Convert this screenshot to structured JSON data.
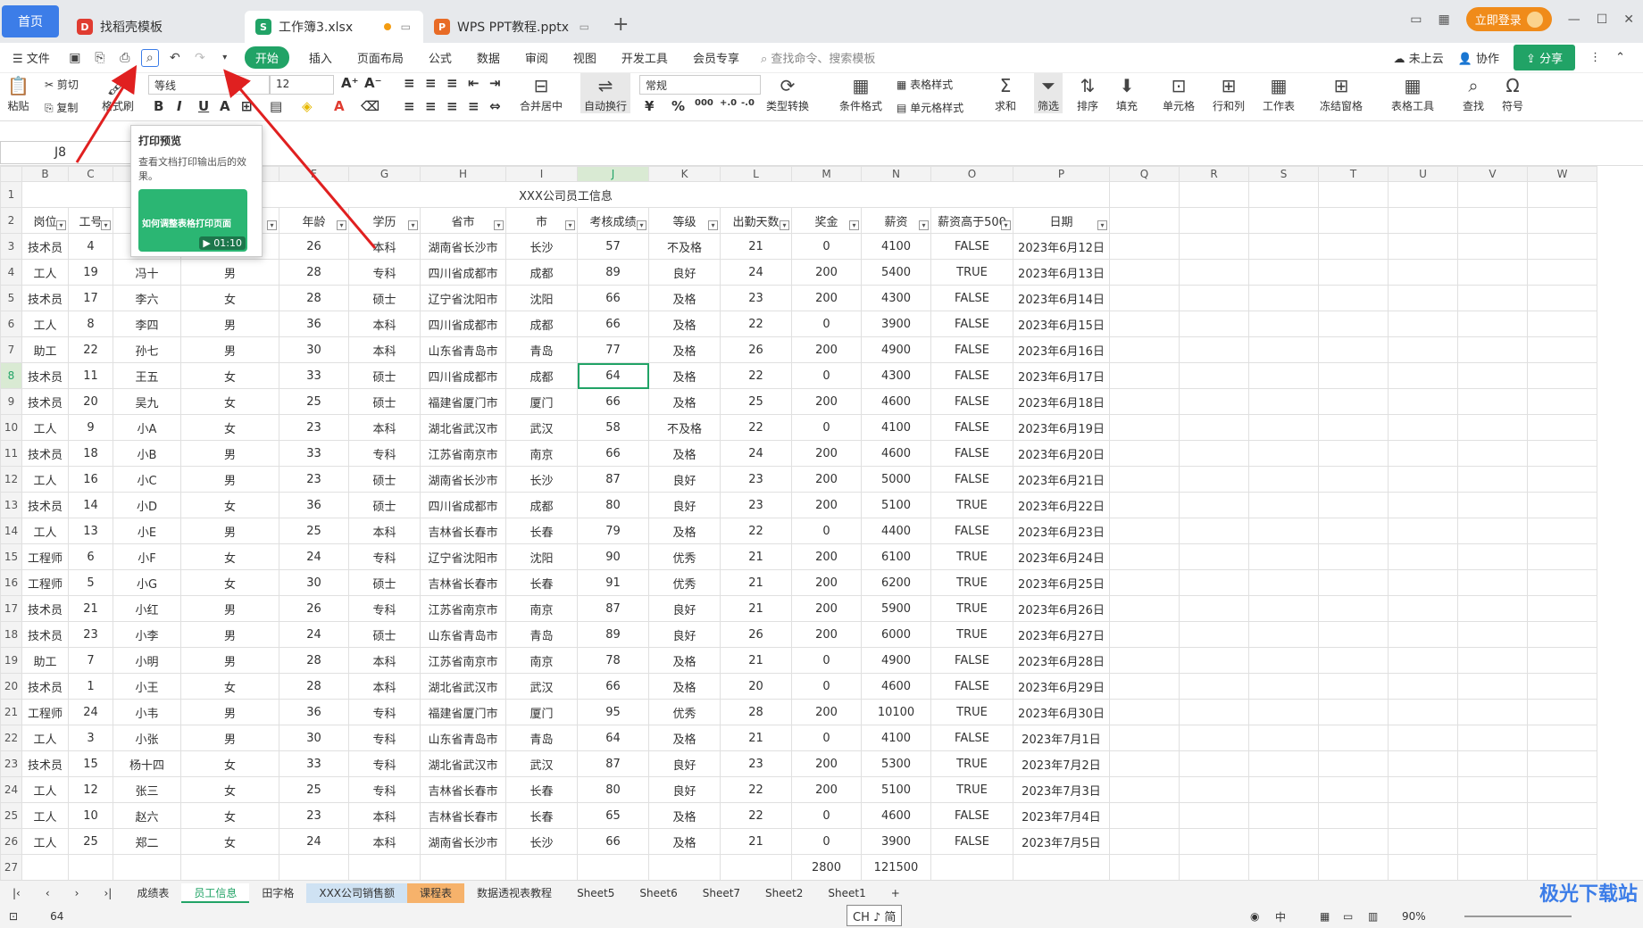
{
  "titlebar": {
    "tabs": [
      {
        "label": "首页"
      },
      {
        "label": "找稻壳模板"
      },
      {
        "label": "工作簿3.xlsx"
      },
      {
        "label": "WPS PPT教程.pptx"
      }
    ],
    "login": "立即登录"
  },
  "menu": {
    "file": "文件",
    "items": [
      "开始",
      "插入",
      "页面布局",
      "公式",
      "数据",
      "审阅",
      "视图",
      "开发工具",
      "会员专享"
    ],
    "search": "查找命令、搜索模板",
    "cloud": "未上云",
    "collab": "协作",
    "share": "分享"
  },
  "ribbon": {
    "cut": "剪切",
    "paste": "粘贴",
    "copy": "复制",
    "fmtbrush": "格式刷",
    "font": "等线",
    "size": "12",
    "merge": "合并居中",
    "wrap": "自动换行",
    "numfmt": "常规",
    "typeconv": "类型转换",
    "condfmt": "条件格式",
    "tablestyle": "表格样式",
    "cellstyle": "单元格样式",
    "sum": "求和",
    "filter": "筛选",
    "sort": "排序",
    "fill": "填充",
    "cell": "单元格",
    "rowcol": "行和列",
    "sheet": "工作表",
    "freeze": "冻结窗格",
    "tabletool": "表格工具",
    "find": "查找",
    "symbol": "符号",
    "currency": "¥",
    "percent": "%",
    "thousands": "000"
  },
  "namebox": "J8",
  "tooltip": {
    "title": "打印预览",
    "desc": "查看文档打印输出后的效果。",
    "card_title": "如何调整表格打印页面",
    "duration": "01:10"
  },
  "columns": [
    "B",
    "C",
    "D",
    "E",
    "F",
    "G",
    "H",
    "I",
    "J",
    "K",
    "L",
    "M",
    "N",
    "O",
    "P",
    "Q",
    "R",
    "S",
    "T",
    "U",
    "V",
    "W"
  ],
  "title_row": "XXX公司员工信息",
  "headers": [
    "岗位",
    "工号",
    "",
    "",
    "年龄",
    "学历",
    "省市",
    "市",
    "考核成绩",
    "等级",
    "出勤天数",
    "奖金",
    "薪资",
    "薪资高于500",
    "日期"
  ],
  "rows": [
    [
      "技术员",
      "4",
      "",
      "",
      "26",
      "本科",
      "湖南省长沙市",
      "长沙",
      "57",
      "不及格",
      "21",
      "0",
      "4100",
      "FALSE",
      "2023年6月12日"
    ],
    [
      "工人",
      "19",
      "冯十",
      "男",
      "28",
      "专科",
      "四川省成都市",
      "成都",
      "89",
      "良好",
      "24",
      "200",
      "5400",
      "TRUE",
      "2023年6月13日"
    ],
    [
      "技术员",
      "17",
      "李六",
      "女",
      "28",
      "硕士",
      "辽宁省沈阳市",
      "沈阳",
      "66",
      "及格",
      "23",
      "200",
      "4300",
      "FALSE",
      "2023年6月14日"
    ],
    [
      "工人",
      "8",
      "李四",
      "男",
      "36",
      "本科",
      "四川省成都市",
      "成都",
      "66",
      "及格",
      "22",
      "0",
      "3900",
      "FALSE",
      "2023年6月15日"
    ],
    [
      "助工",
      "22",
      "孙七",
      "男",
      "30",
      "本科",
      "山东省青岛市",
      "青岛",
      "77",
      "及格",
      "26",
      "200",
      "4900",
      "FALSE",
      "2023年6月16日"
    ],
    [
      "技术员",
      "11",
      "王五",
      "女",
      "33",
      "硕士",
      "四川省成都市",
      "成都",
      "64",
      "及格",
      "22",
      "0",
      "4300",
      "FALSE",
      "2023年6月17日"
    ],
    [
      "技术员",
      "20",
      "吴九",
      "女",
      "25",
      "硕士",
      "福建省厦门市",
      "厦门",
      "66",
      "及格",
      "25",
      "200",
      "4600",
      "FALSE",
      "2023年6月18日"
    ],
    [
      "工人",
      "9",
      "小A",
      "女",
      "23",
      "本科",
      "湖北省武汉市",
      "武汉",
      "58",
      "不及格",
      "22",
      "0",
      "4100",
      "FALSE",
      "2023年6月19日"
    ],
    [
      "技术员",
      "18",
      "小B",
      "男",
      "33",
      "专科",
      "江苏省南京市",
      "南京",
      "66",
      "及格",
      "24",
      "200",
      "4600",
      "FALSE",
      "2023年6月20日"
    ],
    [
      "工人",
      "16",
      "小C",
      "男",
      "23",
      "硕士",
      "湖南省长沙市",
      "长沙",
      "87",
      "良好",
      "23",
      "200",
      "5000",
      "FALSE",
      "2023年6月21日"
    ],
    [
      "技术员",
      "14",
      "小D",
      "女",
      "36",
      "硕士",
      "四川省成都市",
      "成都",
      "80",
      "良好",
      "23",
      "200",
      "5100",
      "TRUE",
      "2023年6月22日"
    ],
    [
      "工人",
      "13",
      "小E",
      "男",
      "25",
      "本科",
      "吉林省长春市",
      "长春",
      "79",
      "及格",
      "22",
      "0",
      "4400",
      "FALSE",
      "2023年6月23日"
    ],
    [
      "工程师",
      "6",
      "小F",
      "女",
      "24",
      "专科",
      "辽宁省沈阳市",
      "沈阳",
      "90",
      "优秀",
      "21",
      "200",
      "6100",
      "TRUE",
      "2023年6月24日"
    ],
    [
      "工程师",
      "5",
      "小G",
      "女",
      "30",
      "硕士",
      "吉林省长春市",
      "长春",
      "91",
      "优秀",
      "21",
      "200",
      "6200",
      "TRUE",
      "2023年6月25日"
    ],
    [
      "技术员",
      "21",
      "小红",
      "男",
      "26",
      "专科",
      "江苏省南京市",
      "南京",
      "87",
      "良好",
      "21",
      "200",
      "5900",
      "TRUE",
      "2023年6月26日"
    ],
    [
      "技术员",
      "23",
      "小李",
      "男",
      "24",
      "硕士",
      "山东省青岛市",
      "青岛",
      "89",
      "良好",
      "26",
      "200",
      "6000",
      "TRUE",
      "2023年6月27日"
    ],
    [
      "助工",
      "7",
      "小明",
      "男",
      "28",
      "本科",
      "江苏省南京市",
      "南京",
      "78",
      "及格",
      "21",
      "0",
      "4900",
      "FALSE",
      "2023年6月28日"
    ],
    [
      "技术员",
      "1",
      "小王",
      "女",
      "28",
      "本科",
      "湖北省武汉市",
      "武汉",
      "66",
      "及格",
      "20",
      "0",
      "4600",
      "FALSE",
      "2023年6月29日"
    ],
    [
      "工程师",
      "24",
      "小韦",
      "男",
      "36",
      "专科",
      "福建省厦门市",
      "厦门",
      "95",
      "优秀",
      "28",
      "200",
      "10100",
      "TRUE",
      "2023年6月30日"
    ],
    [
      "工人",
      "3",
      "小张",
      "男",
      "30",
      "专科",
      "山东省青岛市",
      "青岛",
      "64",
      "及格",
      "21",
      "0",
      "4100",
      "FALSE",
      "2023年7月1日"
    ],
    [
      "技术员",
      "15",
      "杨十四",
      "女",
      "33",
      "专科",
      "湖北省武汉市",
      "武汉",
      "87",
      "良好",
      "23",
      "200",
      "5300",
      "TRUE",
      "2023年7月2日"
    ],
    [
      "工人",
      "12",
      "张三",
      "女",
      "25",
      "专科",
      "吉林省长春市",
      "长春",
      "80",
      "良好",
      "22",
      "200",
      "5100",
      "TRUE",
      "2023年7月3日"
    ],
    [
      "工人",
      "10",
      "赵六",
      "女",
      "23",
      "本科",
      "吉林省长春市",
      "长春",
      "65",
      "及格",
      "22",
      "0",
      "4600",
      "FALSE",
      "2023年7月4日"
    ],
    [
      "工人",
      "25",
      "郑二",
      "女",
      "24",
      "本科",
      "湖南省长沙市",
      "长沙",
      "66",
      "及格",
      "21",
      "0",
      "3900",
      "FALSE",
      "2023年7月5日"
    ]
  ],
  "totals": {
    "bonus": "2800",
    "salary": "121500"
  },
  "sheets": [
    "成绩表",
    "员工信息",
    "田字格",
    "XXX公司销售额",
    "课程表",
    "数据透视表教程",
    "Sheet5",
    "Sheet6",
    "Sheet7",
    "Sheet2",
    "Sheet1"
  ],
  "status": {
    "value": "64",
    "ime": "CH ♪ 简",
    "zoom": "90%"
  },
  "watermark": "极光下载站"
}
